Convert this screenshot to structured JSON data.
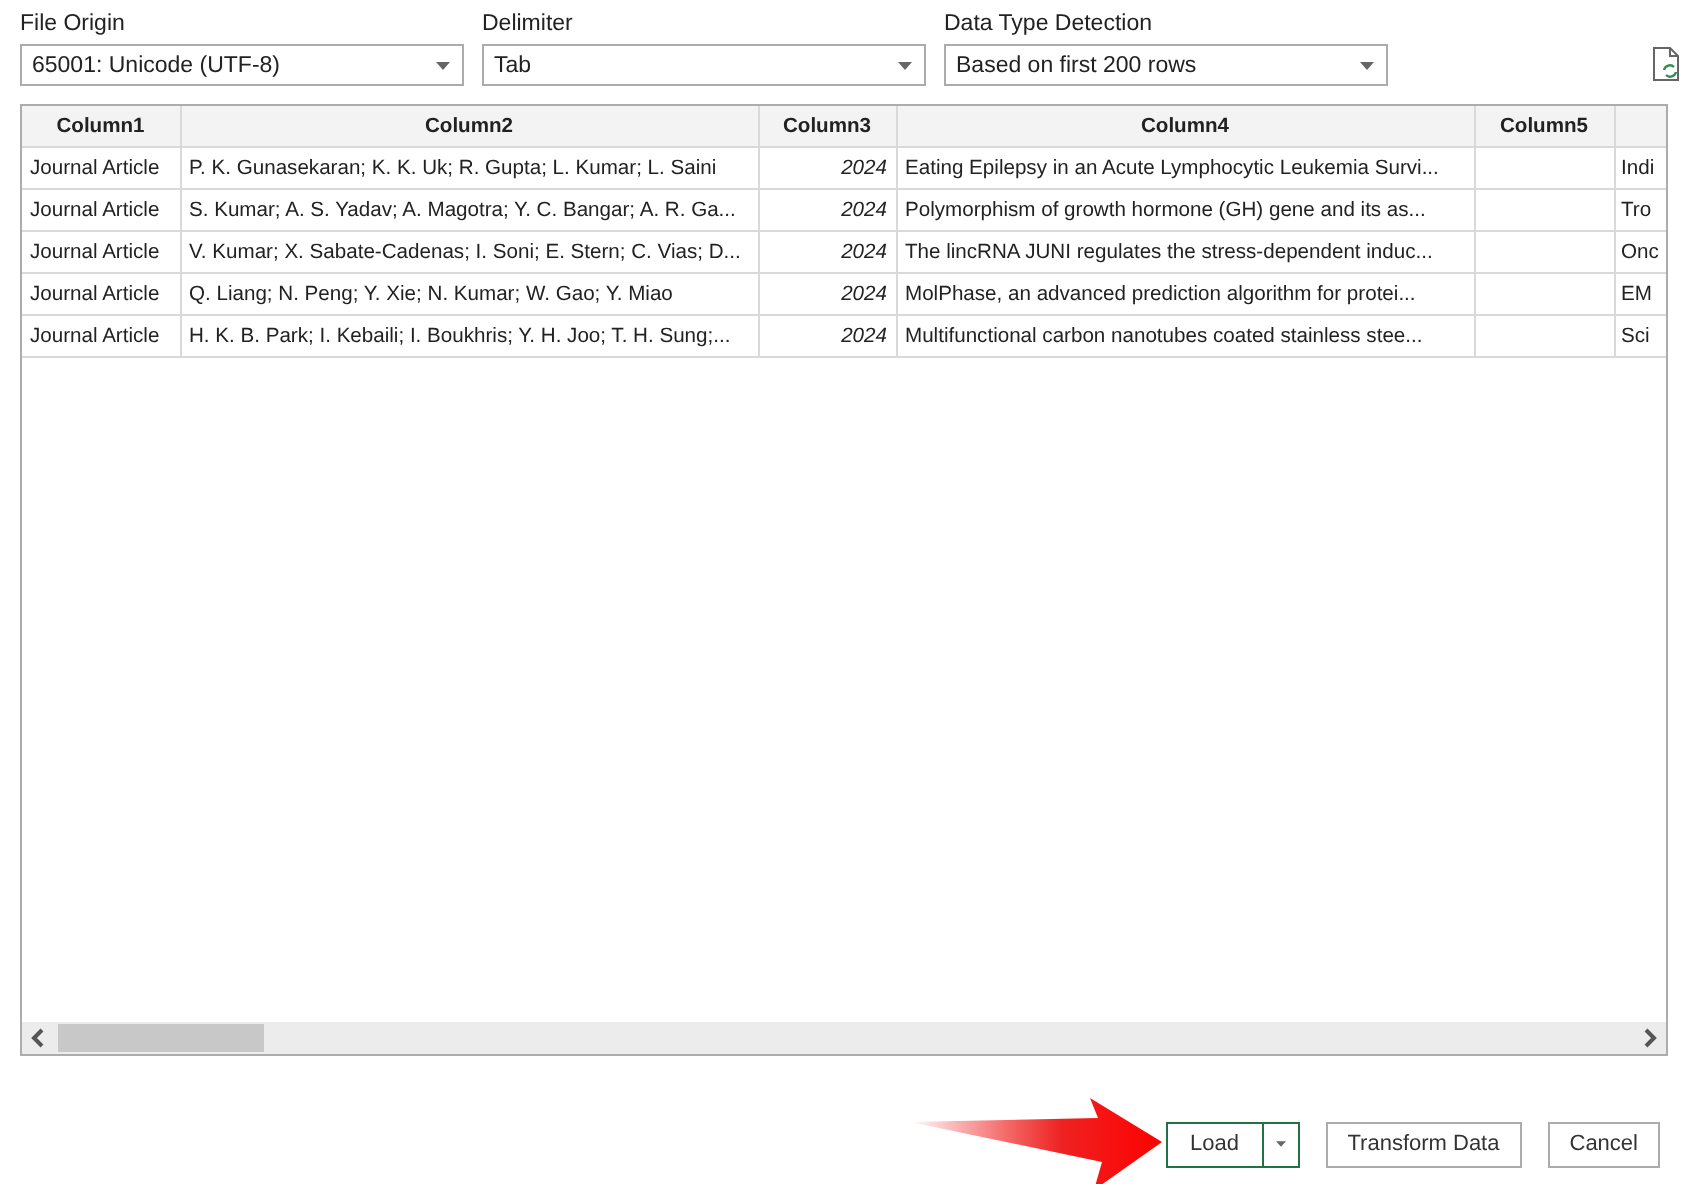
{
  "options": [
    {
      "label": "File Origin",
      "value": "65001: Unicode (UTF-8)"
    },
    {
      "label": "Delimiter",
      "value": "Tab"
    },
    {
      "label": "Data Type Detection",
      "value": "Based on first 200 rows"
    }
  ],
  "table": {
    "columns": [
      {
        "header": "Column1",
        "numeric": false
      },
      {
        "header": "Column2",
        "numeric": false
      },
      {
        "header": "Column3",
        "numeric": true
      },
      {
        "header": "Column4",
        "numeric": false
      },
      {
        "header": "Column5"
      },
      {
        "numeric": false
      }
    ],
    "rows": [
      [
        "Journal Article",
        "P. K. Gunasekaran; K. K. Uk; R. Gupta; L. Kumar; L. Saini",
        "2024",
        "Eating Epilepsy in an Acute Lymphocytic Leukemia Survi...",
        "",
        "Indi"
      ],
      [
        "Journal Article",
        "S. Kumar; A. S. Yadav; A. Magotra; Y. C. Bangar; A. R. Ga...",
        "2024",
        "Polymorphism of growth hormone (GH) gene and its as...",
        "",
        "Tro"
      ],
      [
        "Journal Article",
        "V. Kumar; X. Sabate-Cadenas; I. Soni; E. Stern; C. Vias; D...",
        "2024",
        "The lincRNA JUNI regulates the stress-dependent induc...",
        "",
        "Onc"
      ],
      [
        "Journal Article",
        "Q. Liang; N. Peng; Y. Xie; N. Kumar; W. Gao; Y. Miao",
        "2024",
        "MolPhase, an advanced prediction algorithm for protei...",
        "",
        "EM"
      ],
      [
        "Journal Article",
        "H. K. B. Park; I. Kebaili; I. Boukhris; Y. H. Joo; T. H. Sung;...",
        "2024",
        "Multifunctional carbon nanotubes coated stainless stee...",
        "",
        "Sci"
      ]
    ]
  },
  "buttons": [
    {
      "label": "Load",
      "kind": "split"
    },
    {
      "label": "Transform Data",
      "kind": "plain"
    },
    {
      "label": "Cancel",
      "kind": "plain"
    }
  ]
}
